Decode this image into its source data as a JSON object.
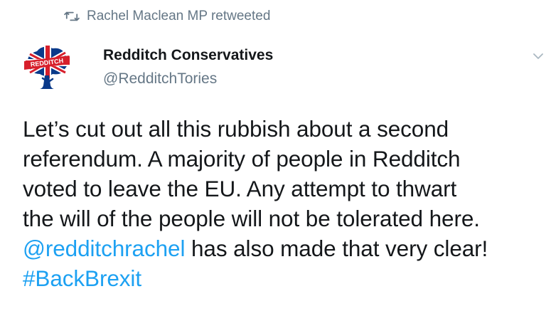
{
  "retweet": {
    "icon": "retweet-icon",
    "text": "Rachel Maclean MP retweeted"
  },
  "author": {
    "name": "Redditch Conservatives",
    "handle": "@RedditchTories",
    "avatar_text": "REDDITCH"
  },
  "menu_icon": "chevron-down-icon",
  "tweet": {
    "line1": "Let’s cut out all this rubbish about a second",
    "line2": "referendum. A majority of people in Redditch",
    "line3": "voted to leave the EU. Any attempt to thwart",
    "line4": "the will of the people will not be tolerated here.",
    "mention": "@redditchrachel",
    "line5_rest": " has also made that very clear!",
    "hashtag": "#BackBrexit"
  },
  "colors": {
    "link": "#1da1f2",
    "secondary": "#657786",
    "text": "#14171a",
    "brand_red": "#d71f2b",
    "brand_blue": "#0a3a8a"
  }
}
